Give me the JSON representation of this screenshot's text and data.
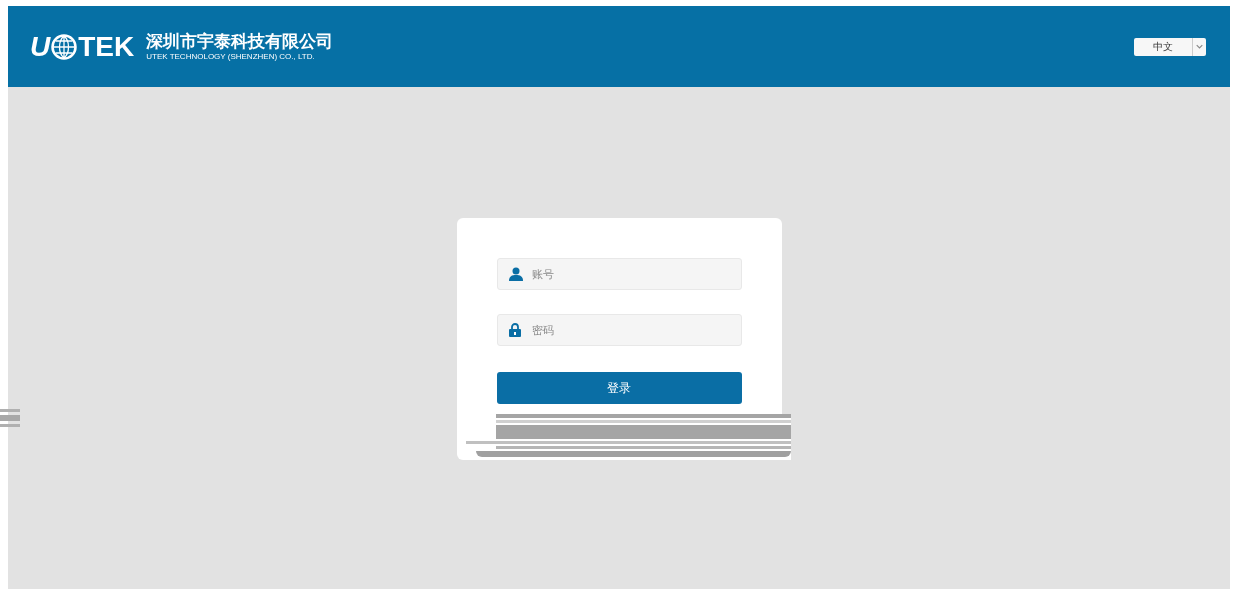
{
  "header": {
    "logo_before": "U",
    "logo_after": "TEK",
    "company_name": "深圳市宇泰科技有限公司",
    "company_name_en": "UTEK TECHNOLOGY (SHENZHEN) CO., LTD.",
    "language": "中文"
  },
  "login": {
    "fields": [
      {
        "kind": "user",
        "placeholder": "账号"
      },
      {
        "kind": "lock",
        "placeholder": "密码"
      }
    ],
    "button": "登录"
  }
}
